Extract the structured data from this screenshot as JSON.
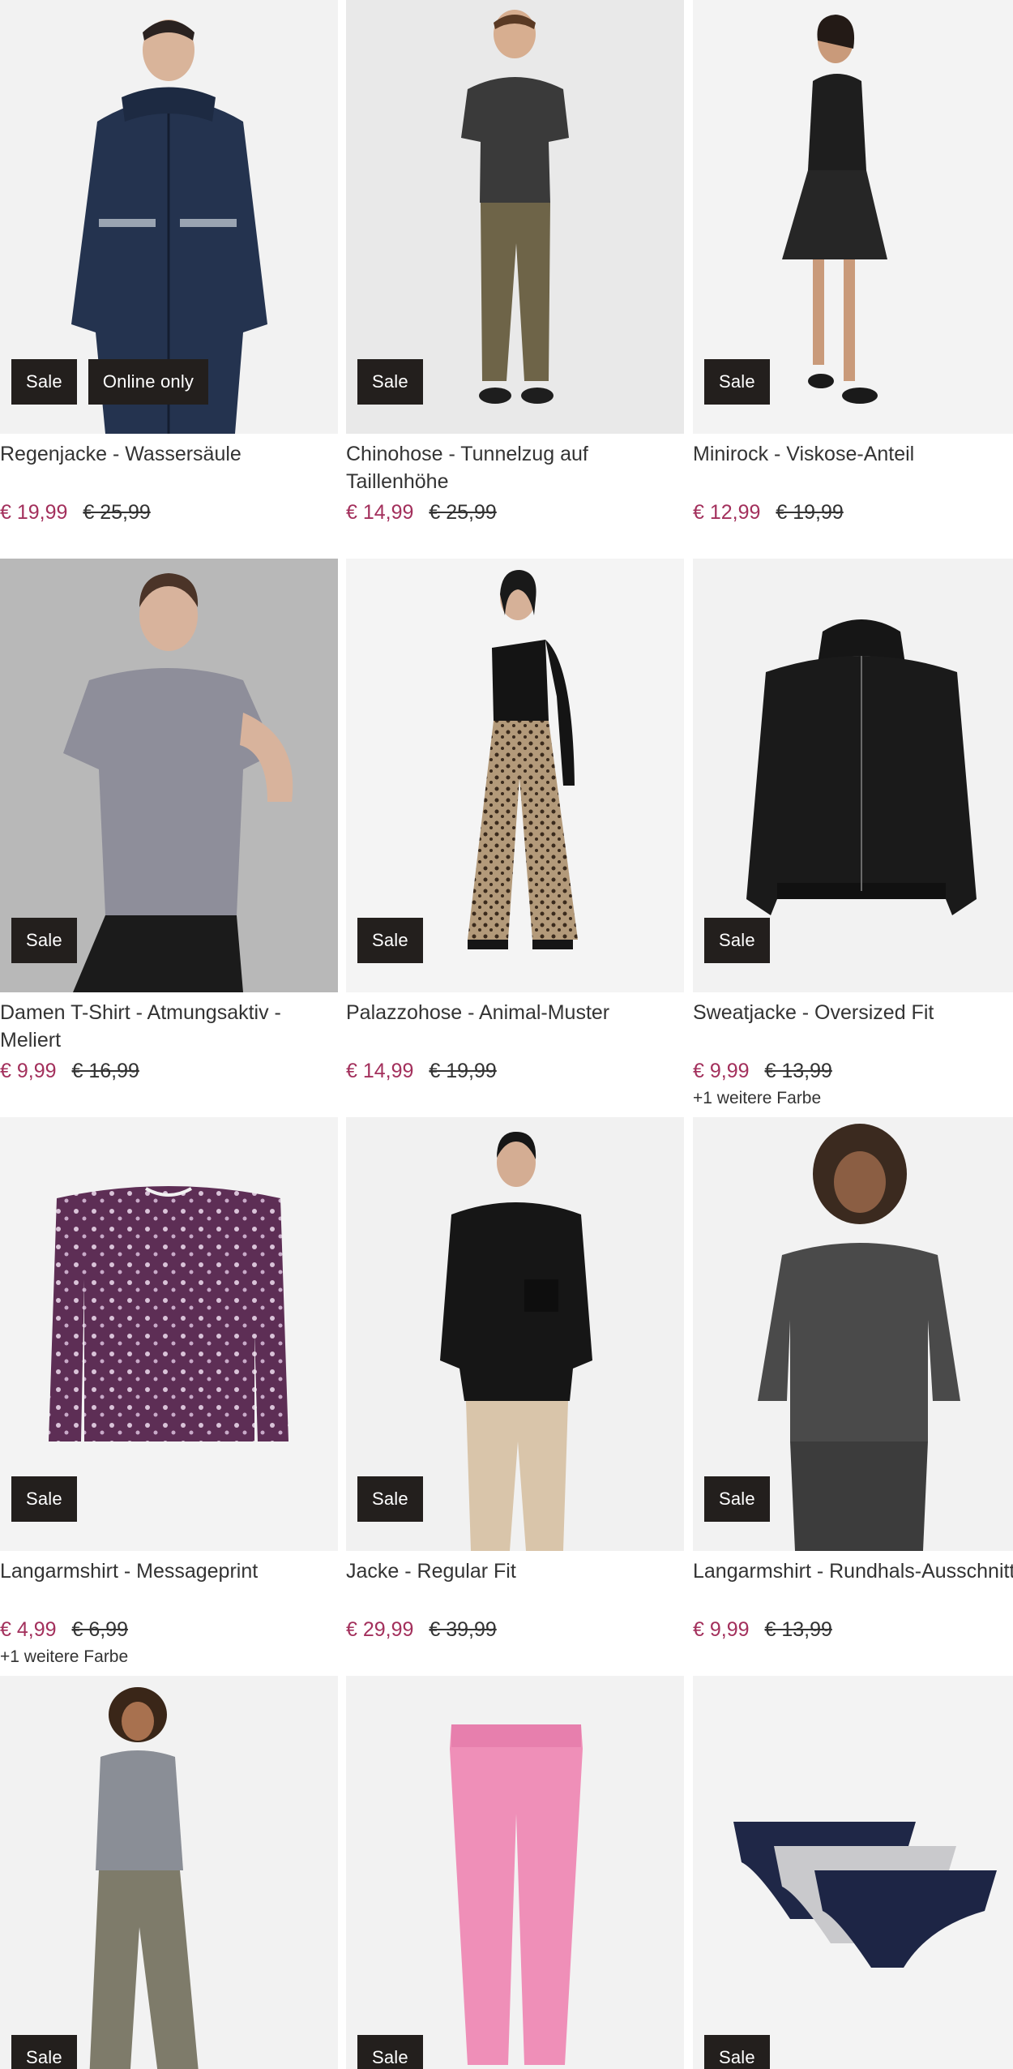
{
  "products": [
    {
      "title": "Regenjacke - Wassersäule",
      "price": "€ 19,99",
      "old_price": "€ 25,99",
      "badges": [
        "Sale",
        "Online only"
      ],
      "more_colors": ""
    },
    {
      "title": "Chinohose - Tunnelzug auf Taillenhöhe",
      "price": "€ 14,99",
      "old_price": "€ 25,99",
      "badges": [
        "Sale"
      ],
      "more_colors": ""
    },
    {
      "title": "Minirock - Viskose-Anteil",
      "price": "€ 12,99",
      "old_price": "€ 19,99",
      "badges": [
        "Sale"
      ],
      "more_colors": ""
    },
    {
      "title": "Damen T-Shirt - Atmungsaktiv - Meliert",
      "price": "€ 9,99",
      "old_price": "€ 16,99",
      "badges": [
        "Sale"
      ],
      "more_colors": ""
    },
    {
      "title": "Palazzohose - Animal-Muster",
      "price": "€ 14,99",
      "old_price": "€ 19,99",
      "badges": [
        "Sale"
      ],
      "more_colors": ""
    },
    {
      "title": "Sweatjacke - Oversized Fit",
      "price": "€ 9,99",
      "old_price": "€ 13,99",
      "badges": [
        "Sale"
      ],
      "more_colors": "+1 weitere Farbe"
    },
    {
      "title": "Langarmshirt - Messageprint",
      "price": "€ 4,99",
      "old_price": "€ 6,99",
      "badges": [
        "Sale"
      ],
      "more_colors": "+1 weitere Farbe"
    },
    {
      "title": "Jacke - Regular Fit",
      "price": "€ 29,99",
      "old_price": "€ 39,99",
      "badges": [
        "Sale"
      ],
      "more_colors": ""
    },
    {
      "title": "Langarmshirt - Rundhals-Ausschnitt",
      "price": "€ 9,99",
      "old_price": "€ 13,99",
      "badges": [
        "Sale"
      ],
      "more_colors": ""
    },
    {
      "title": "",
      "price": "",
      "old_price": "",
      "badges": [
        "Sale"
      ],
      "more_colors": ""
    },
    {
      "title": "",
      "price": "",
      "old_price": "",
      "badges": [
        "Sale"
      ],
      "more_colors": ""
    },
    {
      "title": "",
      "price": "",
      "old_price": "",
      "badges": [
        "Sale"
      ],
      "more_colors": ""
    }
  ],
  "colors": {
    "sale_price": "#a3305c",
    "badge_bg": "#231f1d",
    "text": "#333333"
  }
}
